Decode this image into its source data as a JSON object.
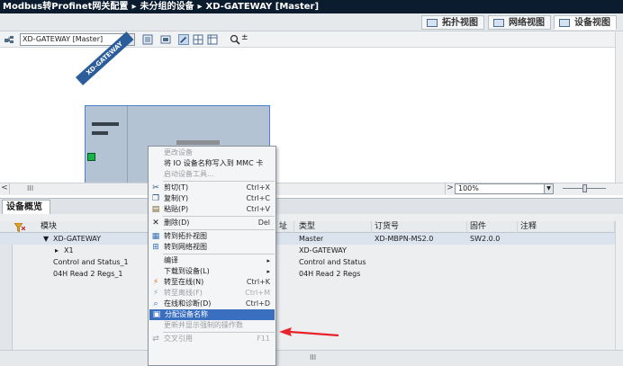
{
  "title_bar": {
    "crumbs": [
      "Modbus转Profinet网关配置",
      "未分组的设备",
      "XD-GATEWAY [Master]"
    ],
    "separator": "▸"
  },
  "view_tabs": [
    {
      "label": "拓扑视图",
      "icon": "topology-view-icon",
      "active": false
    },
    {
      "label": "网络视图",
      "icon": "network-view-icon",
      "active": false
    },
    {
      "label": "设备视图",
      "icon": "device-view-icon",
      "active": true
    }
  ],
  "toolbar": {
    "device_select": "XD-GATEWAY [Master]",
    "zoom_glyph": "±"
  },
  "canvas": {
    "device_label": "XD-GATEWAY"
  },
  "zoom": {
    "value": "100%",
    "hscroll_thumb": "III",
    "scroll_left": "<",
    "scroll_right": ">"
  },
  "overview": {
    "tab_label": "设备概览",
    "columns": [
      "模块",
      "址",
      "类型",
      "订货号",
      "固件",
      "注释"
    ],
    "rows": [
      {
        "module": "XD-GATEWAY",
        "type": "Master",
        "order": "XD-MBPN-MS2.0",
        "firmware": "SW2.0.0",
        "indent": 1,
        "expander": "▼"
      },
      {
        "module": "X1",
        "type": "XD-GATEWAY",
        "order": "",
        "firmware": "",
        "indent": 2,
        "expander": "▸"
      },
      {
        "module": "Control and Status_1",
        "type": "Control and Status",
        "order": "",
        "firmware": "",
        "indent": 1,
        "expander": ""
      },
      {
        "module": "04H Read 2 Regs_1",
        "type": "04H Read 2 Regs",
        "order": "",
        "firmware": "",
        "indent": 1,
        "expander": ""
      }
    ],
    "bottom_scroll": "III"
  },
  "context_menu": {
    "items": [
      {
        "label": "更改设备",
        "shortcut": "",
        "disabled": true,
        "icon": ""
      },
      {
        "label": "将 IO 设备名称写入到 MMC 卡",
        "shortcut": "",
        "disabled": false,
        "icon": ""
      },
      {
        "label": "启动设备工具...",
        "shortcut": "",
        "disabled": true,
        "icon": ""
      },
      {
        "sep": true
      },
      {
        "label": "剪切(T)",
        "shortcut": "Ctrl+X",
        "disabled": false,
        "icon": "cut-icon"
      },
      {
        "label": "复制(Y)",
        "shortcut": "Ctrl+C",
        "disabled": false,
        "icon": "copy-icon"
      },
      {
        "label": "粘贴(P)",
        "shortcut": "Ctrl+V",
        "disabled": false,
        "icon": "paste-icon"
      },
      {
        "sep": true
      },
      {
        "label": "删除(D)",
        "shortcut": "Del",
        "disabled": false,
        "icon": "delete-icon"
      },
      {
        "sep": true
      },
      {
        "label": "转到拓扑视图",
        "shortcut": "",
        "disabled": false,
        "icon": "topology-icon"
      },
      {
        "label": "转到网络视图",
        "shortcut": "",
        "disabled": false,
        "icon": "network-icon"
      },
      {
        "sep": true
      },
      {
        "label": "编译",
        "shortcut": "",
        "disabled": false,
        "icon": "",
        "submenu": true
      },
      {
        "label": "下载到设备(L)",
        "shortcut": "",
        "disabled": false,
        "icon": "",
        "submenu": true
      },
      {
        "label": "转至在线(N)",
        "shortcut": "Ctrl+K",
        "disabled": false,
        "icon": "go-online-icon"
      },
      {
        "label": "转至离线(F)",
        "shortcut": "Ctrl+M",
        "disabled": true,
        "icon": "go-offline-icon"
      },
      {
        "label": "在线和诊断(D)",
        "shortcut": "Ctrl+D",
        "disabled": false,
        "icon": "diagnostics-icon"
      },
      {
        "label": "分配设备名称",
        "shortcut": "",
        "disabled": false,
        "icon": "assign-name-icon",
        "highlight": true
      },
      {
        "label": "更新并显示强制的操作数",
        "shortcut": "",
        "disabled": true,
        "icon": ""
      },
      {
        "sep": true
      },
      {
        "label": "交叉引用",
        "shortcut": "F11",
        "disabled": true,
        "icon": "cross-reference-icon"
      }
    ],
    "submenu_glyph": "▸"
  },
  "colors": {
    "titlebar": "#0b1c2e",
    "highlight": "#3a6fbf",
    "device_body": "#b4c3d3",
    "status_green": "#18b34a",
    "arrow": "#e8232b"
  }
}
